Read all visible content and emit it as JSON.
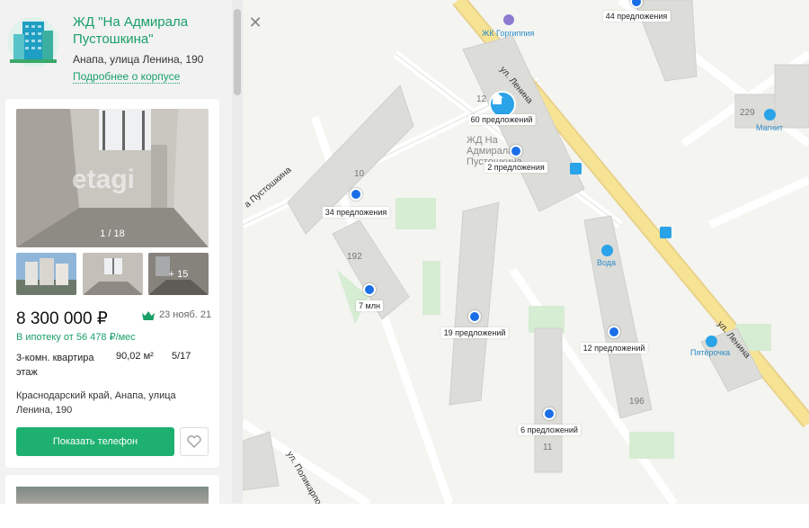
{
  "complex": {
    "title": "ЖД \"На Адмирала Пустошкина\"",
    "address": "Анапа, улица Ленина, 190",
    "more_link": "Подробнее о корпусе"
  },
  "listing": {
    "photo_counter": "1 / 18",
    "photo_watermark": "etagi",
    "thumb_more": "+ 15",
    "price": "8 300 000 ₽",
    "date": "23 нояб. 21",
    "mortgage": "В ипотеку от 56 478 ₽/мес",
    "rooms": "3-комн. квартира этаж",
    "area": "90,02 м²",
    "floor": "5/17",
    "address": "Краснодарский край, Анапа, улица Ленина, 190",
    "phone_button": "Показать телефон",
    "icons": {
      "favorite": "heart-icon",
      "crown": "crown-icon"
    }
  },
  "map": {
    "close_icon": "close-icon",
    "streets": {
      "lenina_top": "ул. Ленина",
      "lenina_bottom": "ул. Ленина",
      "pustoshkina": "а Пустошкина",
      "polikarpova": "ул. Поликарпова"
    },
    "pois": {
      "gorgippia": "ЖК Горгиппия",
      "magnit": "Магнит",
      "voda": "Вода",
      "pyaterochka": "Пятёрочка"
    },
    "complex_label": "ЖД На Адмирала Пустошкина",
    "building_numbers": {
      "b12": "12",
      "b10": "10",
      "b192": "192",
      "b196": "196",
      "b11": "11",
      "b229": "229"
    },
    "markers": [
      {
        "label": "44 предложения"
      },
      {
        "label": "60 предложений"
      },
      {
        "label": "2 предложения"
      },
      {
        "label": "34 предложения"
      },
      {
        "label": "7 млн"
      },
      {
        "label": "19 предложений"
      },
      {
        "label": "12 предложений"
      },
      {
        "label": "6 предложений"
      }
    ]
  },
  "colors": {
    "accent": "#1aa069",
    "button": "#1db06f",
    "marker": "#1a6fe8",
    "road": "#f4d97a"
  }
}
